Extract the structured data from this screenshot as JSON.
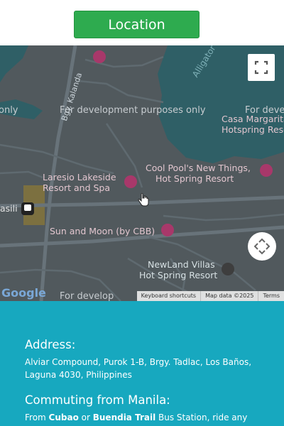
{
  "header": {
    "location_button": "Location"
  },
  "colors": {
    "button": "#2eab4f",
    "info_background": "#17a8bf",
    "map_land": "#51595d",
    "map_water": "#2f5f66"
  },
  "map": {
    "watermarks": [
      "only",
      "For development purposes only",
      "For deve",
      "For develop"
    ],
    "labels": {
      "lake": "Alligator Lake",
      "street": "Bgy. Kalanda",
      "casa_line1": "Casa Margarita",
      "casa_line2": "Hotspring Resort",
      "laresio_line1": "Laresio Lakeside",
      "laresio_line2": "Resort and Spa",
      "coolpool_line1": "Cool Pool's New Things,",
      "coolpool_line2": "Hot Spring Resort",
      "basili": "asili",
      "sunmoon": "Sun and Moon (by CBB)",
      "newland_line1": "NewLand Villas",
      "newland_line2": "Hot Spring Resort"
    },
    "logo": "Google",
    "attribution": {
      "shortcuts": "Keyboard shortcuts",
      "mapdata": "Map data ©2025",
      "terms": "Terms"
    },
    "icons": {
      "fullscreen": "fullscreen-icon",
      "pan": "pan-control-icon",
      "cursor": "hand-cursor-icon"
    }
  },
  "info": {
    "address_heading": "Address:",
    "address_text": "Alviar Compound, Purok 1-B, Brgy. Tadlac, Los Baños, Laguna 4030, Philippines",
    "commute_heading": "Commuting from Manila:",
    "commute_prefix": "From ",
    "commute_cubao": "Cubao",
    "commute_or": " or ",
    "commute_buendia": "Buendia Trail",
    "commute_rest": " Bus Station, ride any"
  }
}
